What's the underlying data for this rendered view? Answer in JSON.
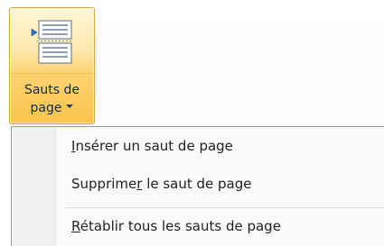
{
  "ribbon": {
    "button": {
      "label_line1": "Sauts de",
      "label_line2": "page",
      "icon": "page-breaks-icon",
      "dropdown_icon": "chevron-down-icon",
      "state": "pressed"
    }
  },
  "menu": {
    "items": [
      {
        "pre": "",
        "mnemonic": "I",
        "post": "nsérer un saut de page",
        "full": "Insérer un saut de page"
      },
      {
        "pre": "Supprime",
        "mnemonic": "r",
        "post": " le saut de page",
        "full": "Supprimer le saut de page"
      },
      {
        "pre": "",
        "mnemonic": "R",
        "post": "établir tous les sauts de page",
        "full": "Rétablir tous les sauts de page"
      }
    ]
  },
  "colors": {
    "button_highlight": "#fbc44c",
    "button_border": "#d4a43a",
    "label_text": "#0f2b4f",
    "menu_text": "#222222",
    "icon_arrow": "#2f6fd1"
  }
}
